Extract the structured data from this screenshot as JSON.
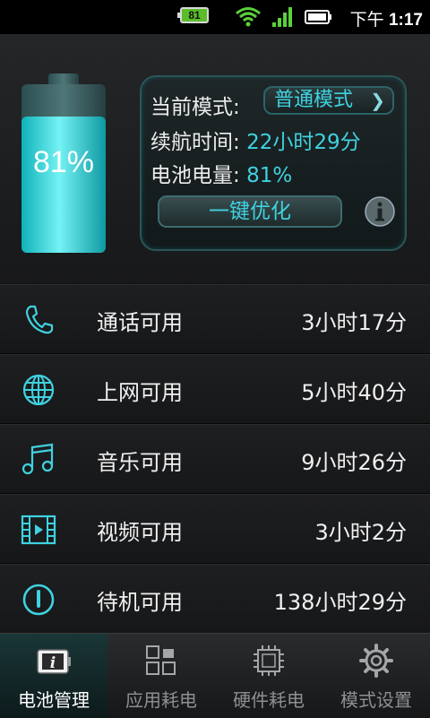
{
  "status_bar": {
    "battery_level": "81",
    "time_prefix": "下午",
    "time": "1:17"
  },
  "battery": {
    "percent": "81%",
    "fill_fraction": 0.81
  },
  "info": {
    "mode_label": "当前模式:",
    "mode_value": "普通模式",
    "endurance_label": "续航时间:",
    "endurance_value": "22小时29分",
    "charge_label": "电池电量:",
    "charge_value": "81%",
    "optimize_button": "一键优化"
  },
  "usage": [
    {
      "icon": "phone-icon",
      "label": "通话可用",
      "value": "3小时17分"
    },
    {
      "icon": "globe-icon",
      "label": "上网可用",
      "value": "5小时40分"
    },
    {
      "icon": "music-icon",
      "label": "音乐可用",
      "value": "9小时26分"
    },
    {
      "icon": "film-icon",
      "label": "视频可用",
      "value": "3小时2分"
    },
    {
      "icon": "power-icon",
      "label": "待机可用",
      "value": "138小时29分"
    }
  ],
  "nav": [
    {
      "icon": "battery-info-icon",
      "label": "电池管理",
      "active": true
    },
    {
      "icon": "apps-grid-icon",
      "label": "应用耗电",
      "active": false
    },
    {
      "icon": "chip-icon",
      "label": "硬件耗电",
      "active": false
    },
    {
      "icon": "gear-icon",
      "label": "模式设置",
      "active": false
    }
  ],
  "colors": {
    "accent": "#3fd2e0",
    "background": "#141516"
  }
}
